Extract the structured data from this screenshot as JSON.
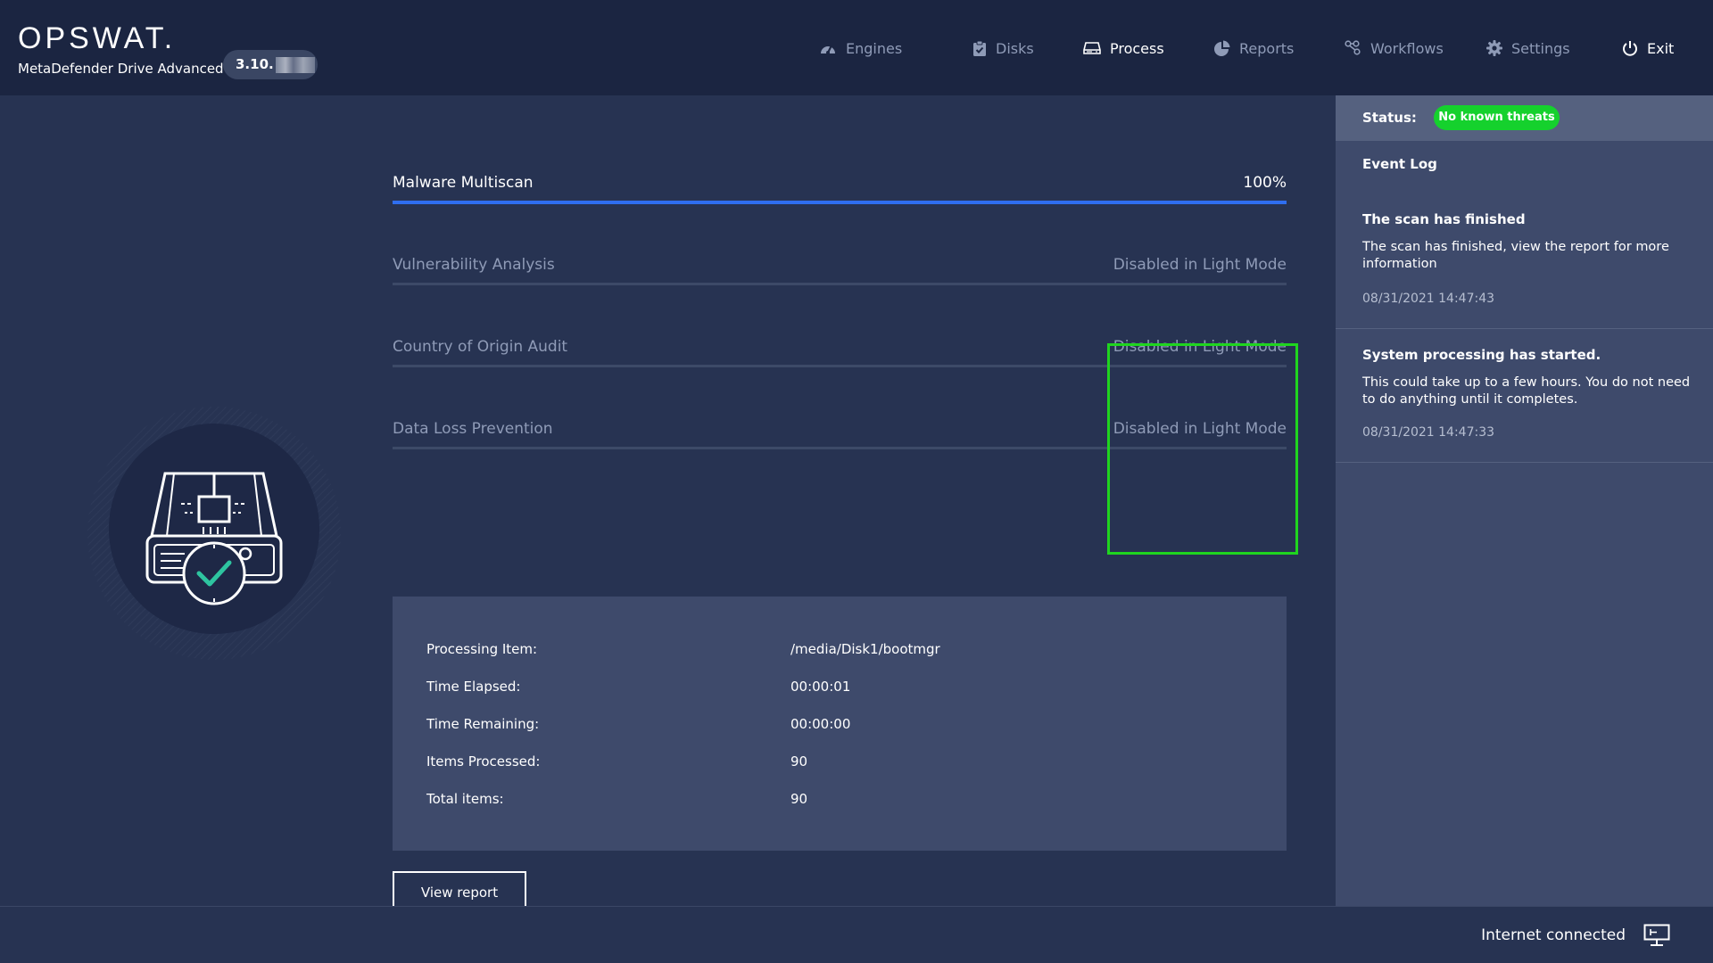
{
  "header": {
    "logo_text": "OPSWAT.",
    "product_name": "MetaDefender Drive Advanced",
    "version": "3.10."
  },
  "nav": [
    {
      "label": "Engines",
      "icon": "gauge-icon",
      "active": false
    },
    {
      "label": "Disks",
      "icon": "clipboard-check-icon",
      "active": false
    },
    {
      "label": "Process",
      "icon": "hard-drive-icon",
      "active": true
    },
    {
      "label": "Reports",
      "icon": "pie-chart-icon",
      "active": false
    },
    {
      "label": "Workflows",
      "icon": "workflow-nodes-icon",
      "active": false
    },
    {
      "label": "Settings",
      "icon": "gear-icon",
      "active": false
    },
    {
      "label": "Exit",
      "icon": "power-icon",
      "active": false
    }
  ],
  "steps": [
    {
      "name": "Malware Multiscan",
      "status": "100%",
      "progress": 1.0
    },
    {
      "name": "Vulnerability Analysis",
      "status": "Disabled in Light Mode",
      "progress": 0
    },
    {
      "name": "Country of Origin Audit",
      "status": "Disabled in Light Mode",
      "progress": 0
    },
    {
      "name": "Data Loss Prevention",
      "status": "Disabled in Light Mode",
      "progress": 0
    }
  ],
  "info": [
    {
      "label": "Processing Item:",
      "value": "/media/Disk1/bootmgr"
    },
    {
      "label": "Time Elapsed:",
      "value": "00:00:01"
    },
    {
      "label": "Time Remaining:",
      "value": "00:00:00"
    },
    {
      "label": "Items Processed:",
      "value": "90"
    },
    {
      "label": "Total items:",
      "value": "90"
    }
  ],
  "view_report_label": "View report",
  "sidebar": {
    "status_label": "Status:",
    "status_value": "No known threats",
    "status_color": "#15d12d",
    "event_log_title": "Event Log",
    "events": [
      {
        "title": "The scan has finished",
        "description": "The scan has finished, view the report for more information",
        "timestamp": "08/31/2021 14:47:43"
      },
      {
        "title": "System processing has started.",
        "description": "This could take up to a few hours. You do not need to do anything until it completes.",
        "timestamp": "08/31/2021 14:47:33"
      }
    ]
  },
  "footer": {
    "connection_status": "Internet connected",
    "connection_icon": "monitor-network-icon"
  },
  "colors": {
    "accent": "#2f6ef0",
    "highlight": "#1fd51f",
    "success": "#15d12d",
    "check": "#2ec4a0"
  }
}
